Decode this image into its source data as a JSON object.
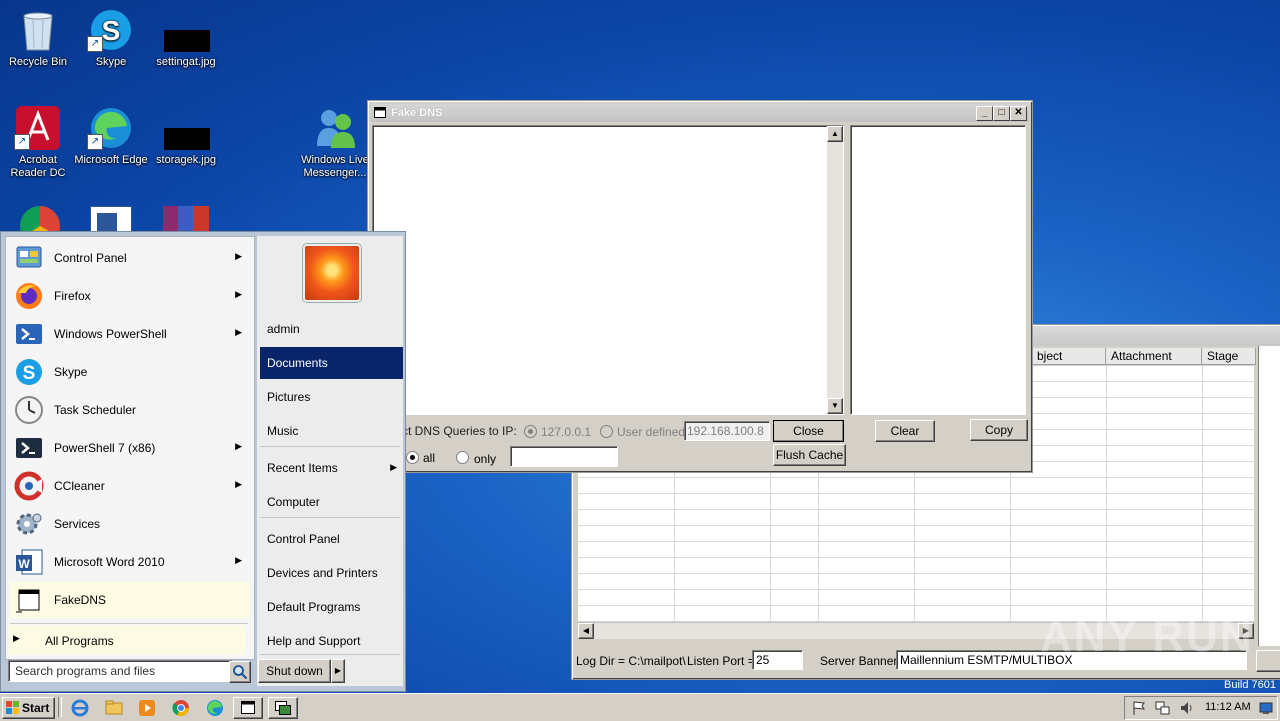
{
  "desktop": {
    "icons": [
      {
        "label": "Recycle Bin"
      },
      {
        "label": "Skype"
      },
      {
        "label": "settingat.jpg"
      },
      {
        "label": "Acrobat Reader DC"
      },
      {
        "label": "Microsoft Edge"
      },
      {
        "label": "storagek.jpg"
      },
      {
        "label": "Windows Live Messenger..."
      }
    ]
  },
  "fakedns": {
    "title": "Fake DNS",
    "redirect_label": "ct DNS Queries to IP:",
    "radio_localhost": "127.0.0.1",
    "radio_user_defined": "User defined",
    "ip_value": "192.168.100.8",
    "radio_all": "all",
    "radio_only": "only",
    "only_value": "",
    "close_label": "Close",
    "flush_label": "Flush Cache",
    "clear_label": "Clear",
    "copy_label": "Copy"
  },
  "mailpot": {
    "columns": [
      "bject",
      "Attachment",
      "Stage"
    ],
    "logdir": "Log Dir = C:\\mailpot\\",
    "listen_label": "Listen Port =",
    "listen_value": "25",
    "banner_label": "Server Banner",
    "banner_value": "Maillennium ESMTP/MULTIBOX"
  },
  "start_menu": {
    "left_items": [
      {
        "label": "Control Panel",
        "arrow": true
      },
      {
        "label": "Firefox",
        "arrow": true
      },
      {
        "label": "Windows PowerShell",
        "arrow": true
      },
      {
        "label": "Skype",
        "arrow": false
      },
      {
        "label": "Task Scheduler",
        "arrow": false
      },
      {
        "label": "PowerShell 7 (x86)",
        "arrow": true
      },
      {
        "label": "CCleaner",
        "arrow": true
      },
      {
        "label": "Services",
        "arrow": false
      },
      {
        "label": "Microsoft Word 2010",
        "arrow": true
      },
      {
        "label": "FakeDNS",
        "arrow": false
      }
    ],
    "all_programs": "All Programs",
    "search_placeholder": "Search programs and files",
    "right_items": [
      "admin",
      "Documents",
      "Pictures",
      "Music",
      "Recent Items",
      "Computer",
      "Control Panel",
      "Devices and Printers",
      "Default Programs",
      "Help and Support"
    ],
    "shutdown_label": "Shut down"
  },
  "taskbar": {
    "start_label": "Start",
    "clock": "11:12 AM"
  },
  "watermark": {
    "text": "ANY RUN",
    "build": "Build 7601"
  }
}
